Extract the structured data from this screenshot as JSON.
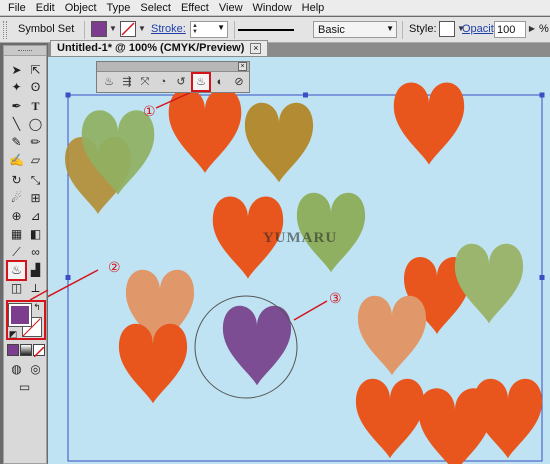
{
  "menu": [
    "File",
    "Edit",
    "Object",
    "Type",
    "Select",
    "Effect",
    "View",
    "Window",
    "Help"
  ],
  "control_bar": {
    "selection_label": "Symbol Set",
    "stroke_label": "Stroke:",
    "style_label": "Style:",
    "opacity_label": "Opacity:",
    "opacity_value": "100",
    "opacity_unit": "%",
    "brush_label": "Basic",
    "fill_color": "#7c3d8f"
  },
  "document_tab": {
    "title": "Untitled-1* @ 100% (CMYK/Preview)",
    "close_glyph": "×"
  },
  "symbolism_panel": {
    "close_glyph": "×",
    "tools": [
      "symbol-sprayer",
      "symbol-shifter",
      "symbol-scruncher",
      "symbol-sizer",
      "symbol-spinner",
      "symbol-stainer",
      "symbol-screener",
      "symbol-styler"
    ],
    "selected_tool": "symbol-stainer"
  },
  "canvas": {
    "watermark": "YUMARU"
  },
  "annotations": [
    "①",
    "②",
    "③"
  ],
  "colors": {
    "canvas_bg": "#bfe3f2",
    "heart_orange": "#e8561e",
    "heart_olive": "#b38b32",
    "heart_green": "#8fb061",
    "heart_peach": "#e0976a",
    "heart_purple": "#7c4d92",
    "highlight_red": "#d3141b"
  }
}
